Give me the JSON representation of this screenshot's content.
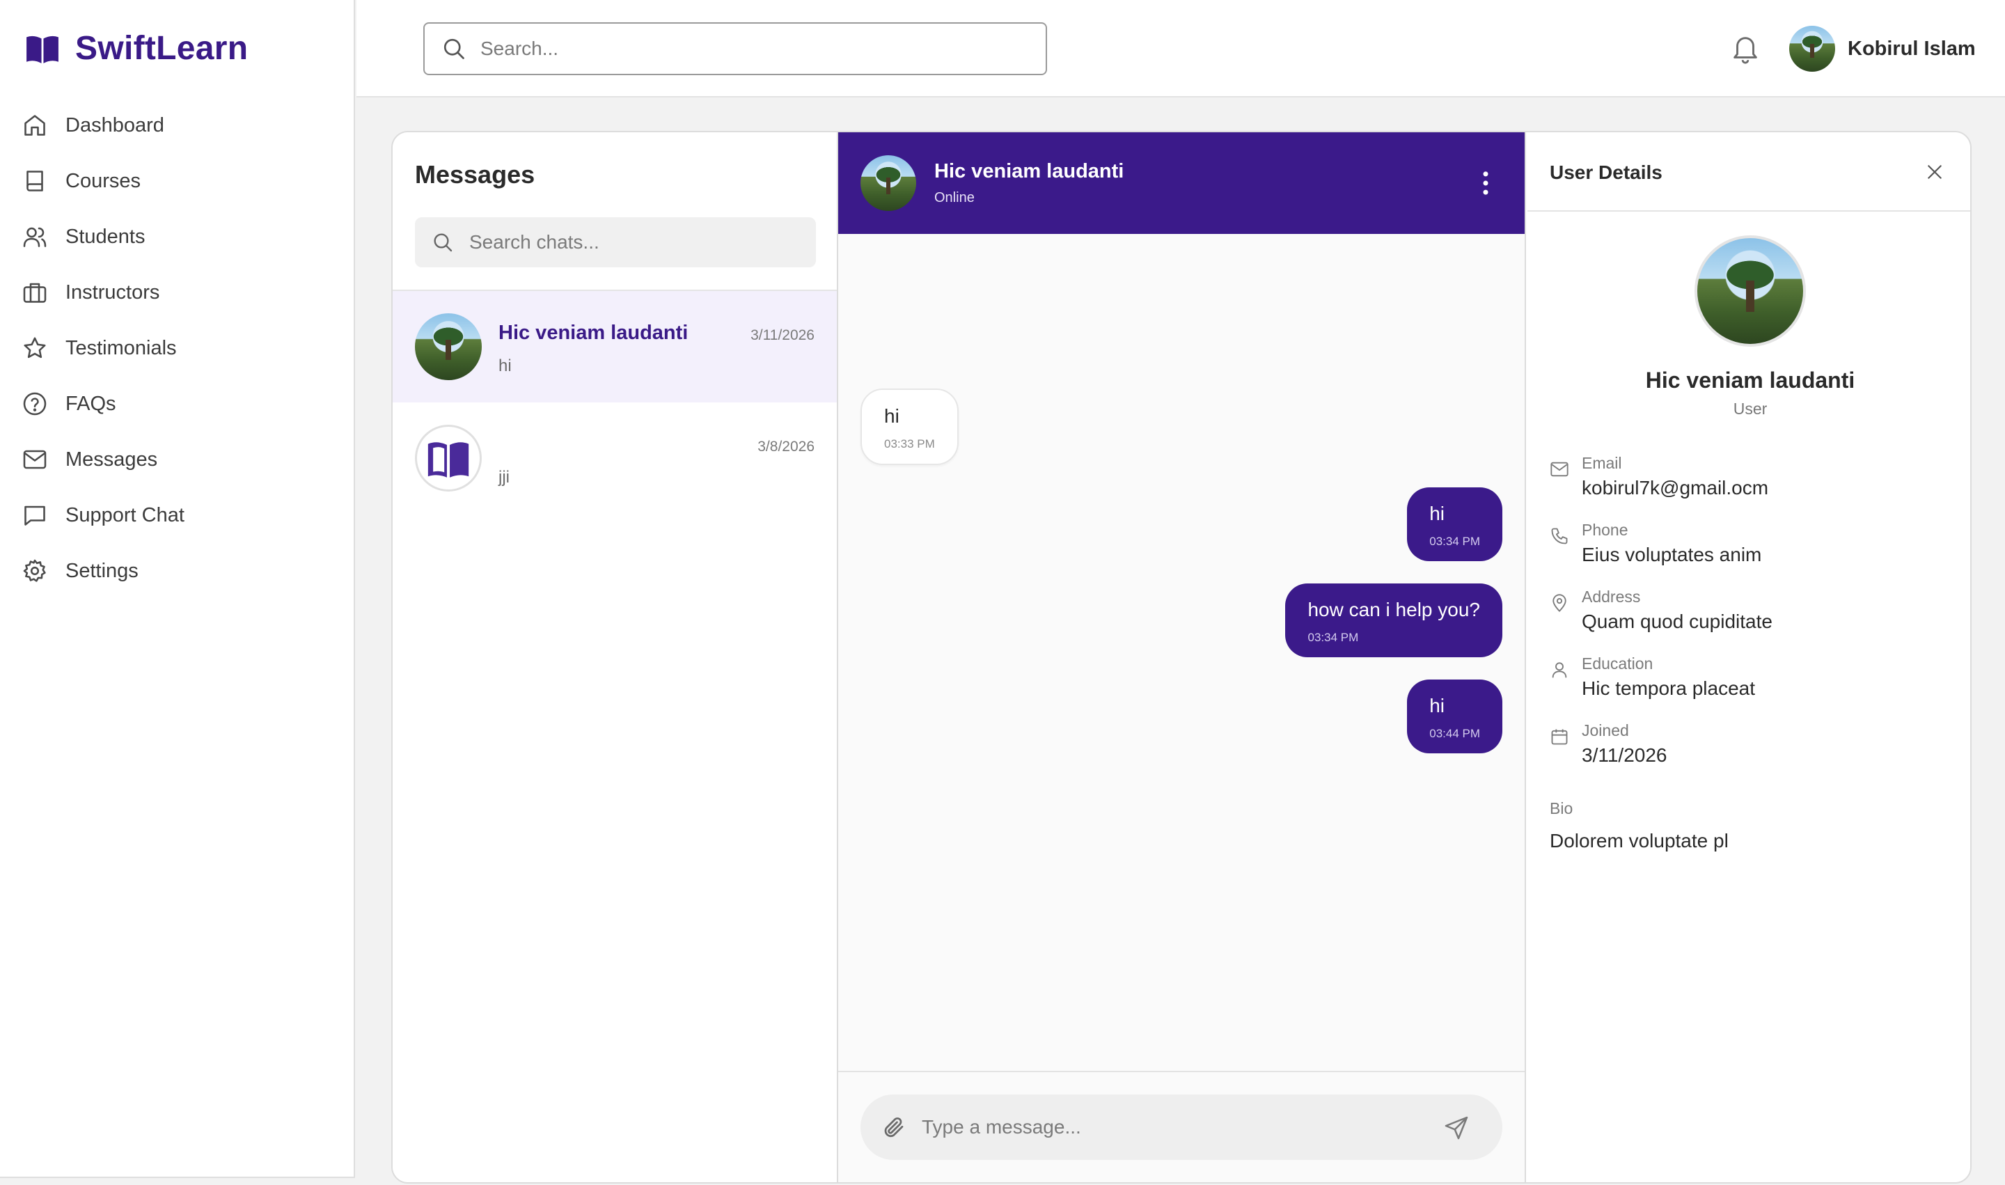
{
  "brand": {
    "name": "SwiftLearn",
    "color": "#3a1a87"
  },
  "sidebar": {
    "items": [
      {
        "label": "Dashboard",
        "icon": "home-icon"
      },
      {
        "label": "Courses",
        "icon": "book-icon"
      },
      {
        "label": "Students",
        "icon": "users-icon"
      },
      {
        "label": "Instructors",
        "icon": "briefcase-icon"
      },
      {
        "label": "Testimonials",
        "icon": "star-icon"
      },
      {
        "label": "FAQs",
        "icon": "help-circle-icon"
      },
      {
        "label": "Messages",
        "icon": "mail-icon"
      },
      {
        "label": "Support Chat",
        "icon": "chat-icon"
      },
      {
        "label": "Settings",
        "icon": "gear-icon"
      }
    ]
  },
  "topbar": {
    "search_placeholder": "Search...",
    "user_name": "Kobirul Islam"
  },
  "messages_panel": {
    "title": "Messages",
    "search_placeholder": "Search chats...",
    "chats": [
      {
        "name": "Hic veniam laudanti",
        "preview": "hi",
        "date": "3/11/2026",
        "active": true
      },
      {
        "name": "",
        "preview": "jji",
        "date": "3/8/2026",
        "active": false
      }
    ]
  },
  "conversation": {
    "contact_name": "Hic veniam laudanti",
    "status": "Online",
    "header_color": "#3b1a8a",
    "messages": [
      {
        "direction": "in",
        "text": "hi",
        "time": "03:33 PM"
      },
      {
        "direction": "out",
        "text": "hi",
        "time": "03:34 PM"
      },
      {
        "direction": "out",
        "text": "how can i help you?",
        "time": "03:34 PM"
      },
      {
        "direction": "out",
        "text": "hi",
        "time": "03:44 PM"
      }
    ],
    "composer_placeholder": "Type a message..."
  },
  "details": {
    "title": "User Details",
    "name": "Hic veniam laudanti",
    "role": "User",
    "fields": [
      {
        "label": "Email",
        "value": "kobirul7k@gmail.ocm",
        "icon": "mail-icon"
      },
      {
        "label": "Phone",
        "value": "Eius voluptates anim",
        "icon": "phone-icon"
      },
      {
        "label": "Address",
        "value": "Quam quod cupiditate",
        "icon": "map-pin-icon"
      },
      {
        "label": "Education",
        "value": "Hic tempora placeat",
        "icon": "user-icon"
      },
      {
        "label": "Joined",
        "value": "3/11/2026",
        "icon": "calendar-icon"
      }
    ],
    "bio_label": "Bio",
    "bio": "Dolorem voluptate pl"
  }
}
